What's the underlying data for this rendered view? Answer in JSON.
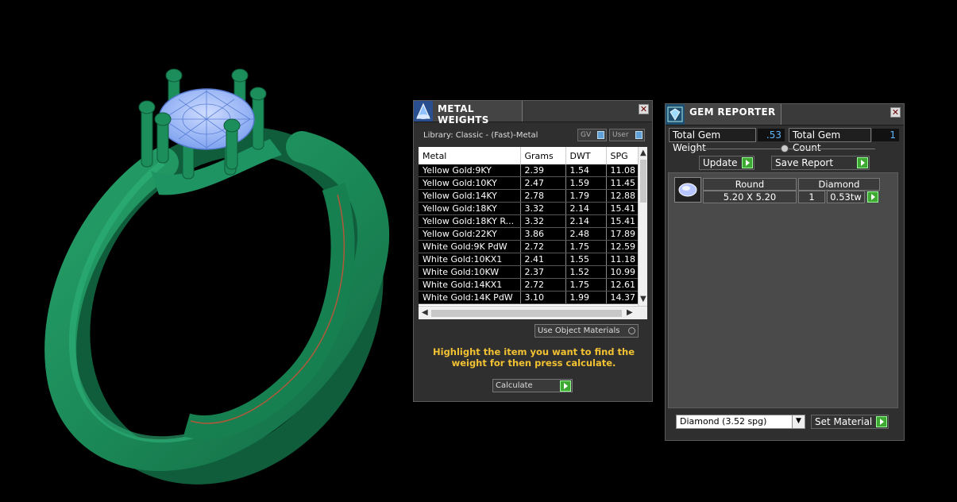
{
  "colors": {
    "ring_green": "#1d9060",
    "gem_blue": "#8fb4ff",
    "accent_yellow": "#f2c232",
    "value_blue": "#5fb8ff",
    "button_green": "#3da832"
  },
  "metal_weights": {
    "title": "METAL WEIGHTS",
    "icon": "metal-weights-icon",
    "library_label": "Library: Classic - (Fast)-Metal",
    "gv_label": "GV",
    "user_label": "User",
    "columns": [
      "Metal",
      "Grams",
      "DWT",
      "SPG"
    ],
    "rows": [
      [
        "Yellow Gold:9KY",
        "2.39",
        "1.54",
        "11.08"
      ],
      [
        "Yellow Gold:10KY",
        "2.47",
        "1.59",
        "11.45"
      ],
      [
        "Yellow Gold:14KY",
        "2.78",
        "1.79",
        "12.88"
      ],
      [
        "Yellow Gold:18KY",
        "3.32",
        "2.14",
        "15.41"
      ],
      [
        "Yellow Gold:18KY R...",
        "3.32",
        "2.14",
        "15.41"
      ],
      [
        "Yellow Gold:22KY",
        "3.86",
        "2.48",
        "17.89"
      ],
      [
        "White Gold:9K PdW",
        "2.72",
        "1.75",
        "12.59"
      ],
      [
        "White Gold:10KX1",
        "2.41",
        "1.55",
        "11.18"
      ],
      [
        "White Gold:10KW",
        "2.37",
        "1.52",
        "10.99"
      ],
      [
        "White Gold:14KX1",
        "2.72",
        "1.75",
        "12.61"
      ],
      [
        "White Gold:14K PdW",
        "3.10",
        "1.99",
        "14.37"
      ]
    ],
    "use_object_materials": "Use Object Materials",
    "hint": "Highlight the item you want to find the weight for then press calculate.",
    "calculate_label": "Calculate"
  },
  "gem_reporter": {
    "title": "GEM REPORTER",
    "icon": "gem-reporter-icon",
    "total_weight_label": "Total Gem Weight",
    "total_weight_value": ".53",
    "total_count_label": "Total Gem Count",
    "total_count_value": "1",
    "update_label": "Update",
    "save_report_label": "Save Report",
    "gem": {
      "shape": "Round",
      "material": "Diamond",
      "size": "5.20 X 5.20",
      "count": "1",
      "weight": "0.53tw"
    },
    "material_select": "Diamond     (3.52 spg)",
    "set_material_label": "Set Material"
  }
}
